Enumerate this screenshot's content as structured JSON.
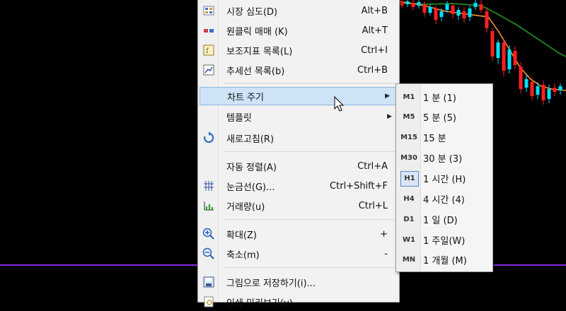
{
  "context_menu": {
    "items": [
      {
        "label": "시장 심도(D)",
        "shortcut": "Alt+B",
        "icon": "market-depth-icon"
      },
      {
        "label": "원클릭 매매 (K)",
        "shortcut": "Alt+T",
        "icon": "one-click-trading-icon"
      },
      {
        "label": "보조지표 목록(L)",
        "shortcut": "Ctrl+I",
        "icon": "indicators-list-icon"
      },
      {
        "label": "추세선 목록(b)",
        "shortcut": "Ctrl+B",
        "icon": "trendline-list-icon"
      },
      {
        "label": "차트 주기",
        "shortcut": "",
        "icon": ""
      },
      {
        "label": "템플릿",
        "shortcut": "",
        "icon": ""
      },
      {
        "label": "새로고침(R)",
        "shortcut": "",
        "icon": "refresh-icon"
      },
      {
        "label": "자동 정렬(A)",
        "shortcut": "Ctrl+A",
        "icon": ""
      },
      {
        "label": "눈금선(G)...",
        "shortcut": "Ctrl+Shift+F",
        "icon": "grid-icon"
      },
      {
        "label": "거래량(u)",
        "shortcut": "Ctrl+L",
        "icon": "volume-icon"
      },
      {
        "label": "확대(Z)",
        "shortcut": "+",
        "icon": "zoom-in-icon"
      },
      {
        "label": "축소(m)",
        "shortcut": "-",
        "icon": "zoom-out-icon"
      },
      {
        "label": "그림으로 저장하기(i)...",
        "shortcut": "",
        "icon": "save-picture-icon"
      },
      {
        "label": "인쇄 미리보기(v)",
        "shortcut": "",
        "icon": "print-preview-icon"
      }
    ]
  },
  "timeframe_submenu": {
    "items": [
      {
        "code": "M1",
        "label": "1 분 (1)"
      },
      {
        "code": "M5",
        "label": "5 분 (5)"
      },
      {
        "code": "M15",
        "label": "15 분"
      },
      {
        "code": "M30",
        "label": "30 분 (3)"
      },
      {
        "code": "H1",
        "label": "1 시간 (H)"
      },
      {
        "code": "H4",
        "label": "4 시간 (4)"
      },
      {
        "code": "D1",
        "label": "1 일 (D)"
      },
      {
        "code": "W1",
        "label": "1 주일(W)"
      },
      {
        "code": "MN",
        "label": "1 개월 (M)"
      }
    ],
    "active_code": "H1"
  },
  "colors": {
    "background": "#000000",
    "bull_candle": "#00e0ff",
    "bear_candle": "#ff2020",
    "ma_fast": "#ff9a3c",
    "ma_slow": "#1e7a1e",
    "level_line": "#8a2be2"
  }
}
